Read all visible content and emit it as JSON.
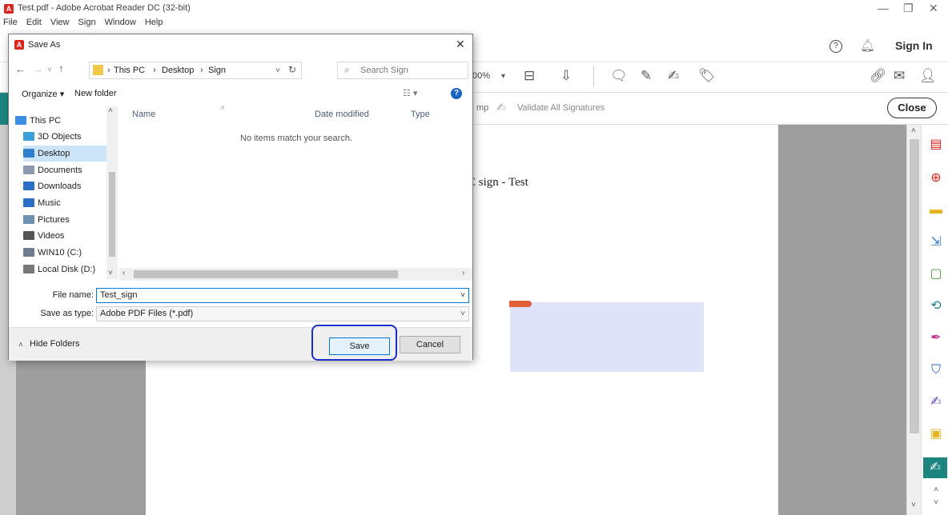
{
  "window": {
    "title": "Test.pdf - Adobe Acrobat Reader DC (32-bit)"
  },
  "menu": [
    "File",
    "Edit",
    "View",
    "Sign",
    "Window",
    "Help"
  ],
  "topbar": {
    "sign_in": "Sign In"
  },
  "toolbar": {
    "zoom": "00%"
  },
  "sign_bar": {
    "stamp_partial": "mp",
    "validate": "Validate All Signatures",
    "close": "Close"
  },
  "document": {
    "text": "C sign - Test"
  },
  "dialog": {
    "title": "Save As",
    "breadcrumb": [
      "This PC",
      "Desktop",
      "Sign"
    ],
    "search_placeholder": "Search Sign",
    "organize": "Organize ▾",
    "new_folder": "New folder",
    "nav_items": [
      {
        "label": "This PC",
        "icon": "pc-icon",
        "color": "#3a8ee6"
      },
      {
        "label": "3D Objects",
        "icon": "cube-icon",
        "color": "#3aa0d9"
      },
      {
        "label": "Desktop",
        "icon": "desktop-icon",
        "color": "#2f7fd1"
      },
      {
        "label": "Documents",
        "icon": "document-icon",
        "color": "#8a9bb0"
      },
      {
        "label": "Downloads",
        "icon": "download-icon",
        "color": "#2b6fc6"
      },
      {
        "label": "Music",
        "icon": "music-icon",
        "color": "#2b6fc6"
      },
      {
        "label": "Pictures",
        "icon": "pictures-icon",
        "color": "#6e8fb0"
      },
      {
        "label": "Videos",
        "icon": "video-icon",
        "color": "#555555"
      },
      {
        "label": "WIN10 (C:)",
        "icon": "drive-icon",
        "color": "#6d7d8f"
      },
      {
        "label": "Local Disk (D:)",
        "icon": "drive-icon",
        "color": "#777777"
      }
    ],
    "columns": [
      "Name",
      "Date modified",
      "Type"
    ],
    "empty_message": "No items match your search.",
    "file_name_label": "File name:",
    "file_name_value": "Test_sign",
    "save_type_label": "Save as type:",
    "save_type_value": "Adobe PDF Files (*.pdf)",
    "hide_folders": "Hide Folders",
    "save": "Save",
    "cancel": "Cancel"
  },
  "colors": {
    "accent": "#0078d7",
    "highlight": "#1a2ecc",
    "acrobat_red": "#d9271b",
    "sign_teal": "#1c8580"
  }
}
